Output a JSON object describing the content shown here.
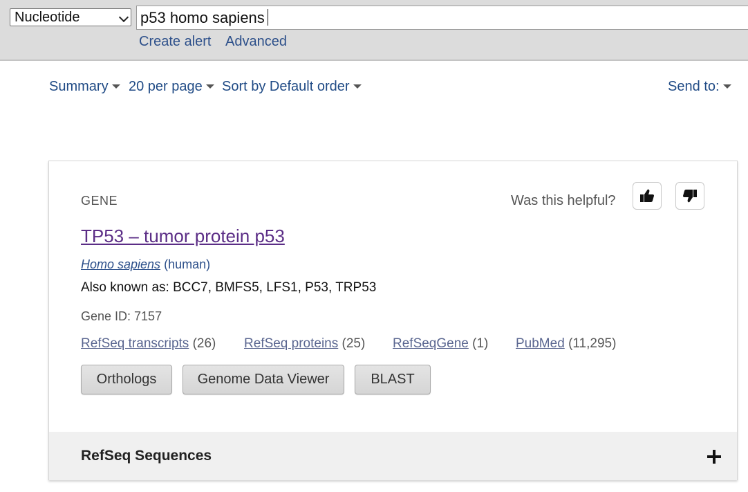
{
  "search": {
    "database": "Nucleotide",
    "query": "p53 homo sapiens",
    "create_alert": "Create alert",
    "advanced": "Advanced"
  },
  "display_options": {
    "format": "Summary",
    "per_page": "20 per page",
    "sort": "Sort by Default order",
    "send_to": "Send to:"
  },
  "gene_card": {
    "section_label": "GENE",
    "helpful_question": "Was this helpful?",
    "thumbs_up_icon": "thumbs-up-icon",
    "thumbs_down_icon": "thumbs-down-icon",
    "title": "TP53 – tumor protein p53",
    "organism_scientific": "Homo sapiens",
    "organism_common": "(human)",
    "also_known_as": "Also known as: BCC7, BMFS5, LFS1, P53, TRP53",
    "gene_id": "Gene ID: 7157",
    "links": [
      {
        "label": "RefSeq transcripts",
        "count": "(26)"
      },
      {
        "label": "RefSeq proteins",
        "count": "(25)"
      },
      {
        "label": "RefSeqGene",
        "count": "(1)"
      },
      {
        "label": "PubMed",
        "count": "(11,295)"
      }
    ],
    "buttons": {
      "orthologs": "Orthologs",
      "genome_data_viewer": "Genome Data Viewer",
      "blast": "BLAST"
    },
    "refseq_section": {
      "title": "RefSeq Sequences",
      "expand_icon": "plus-icon"
    }
  },
  "colors": {
    "link_blue": "#1f4a85",
    "visited_purple": "#5b2d86",
    "search_bar_bg": "#dcdcdc"
  }
}
